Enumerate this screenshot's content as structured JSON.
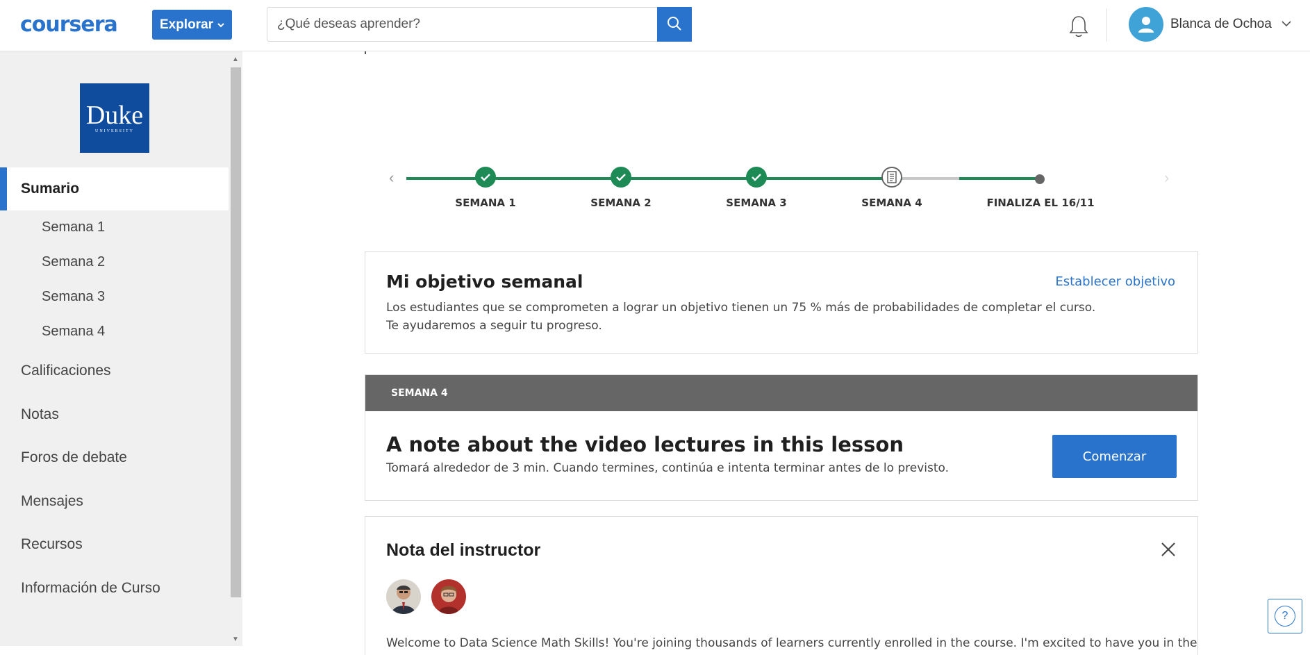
{
  "header": {
    "logo": "coursera",
    "explore_label": "Explorar",
    "search_placeholder": "¿Qué deseas aprender?",
    "user_name": "Blanca de Ochoa",
    "accent_color": "#2a73cc"
  },
  "sidebar": {
    "logo_text": "Duke",
    "logo_subtext": "UNIVERSITY",
    "active_item": "Sumario",
    "sub_items": [
      "Semana 1",
      "Semana 2",
      "Semana 3",
      "Semana 4"
    ],
    "items": [
      "Calificaciones",
      "Notas",
      "Foros de debate",
      "Mensajes",
      "Recursos",
      "Información de Curso"
    ]
  },
  "timeline": {
    "steps": [
      {
        "label": "SEMANA 1",
        "status": "complete"
      },
      {
        "label": "SEMANA 2",
        "status": "complete"
      },
      {
        "label": "SEMANA 3",
        "status": "complete"
      },
      {
        "label": "SEMANA 4",
        "status": "current"
      },
      {
        "label": "FINALIZA EL 16/11",
        "status": "end"
      }
    ],
    "complete_color": "#1e8a55"
  },
  "goal": {
    "title": "Mi objetivo semanal",
    "link": "Establecer objetivo",
    "line1": "Los estudiantes que se comprometen a lograr un objetivo tienen un 75 % más de probabilidades de completar el curso.",
    "line2": "Te ayudaremos a seguir tu progreso."
  },
  "week": {
    "band_label": "SEMANA 4",
    "lesson_title": "A note about the video lectures in this lesson",
    "lesson_sub": "Tomará alrededor de 3 min. Cuando termines, continúa e intenta terminar antes de lo previsto.",
    "start_label": "Comenzar"
  },
  "note": {
    "title": "Nota del instructor",
    "text": "Welcome to Data Science Math Skills! You're joining thousands of learners currently enrolled in the course. I'm excited to have you in the"
  },
  "help": {
    "label": "?"
  }
}
